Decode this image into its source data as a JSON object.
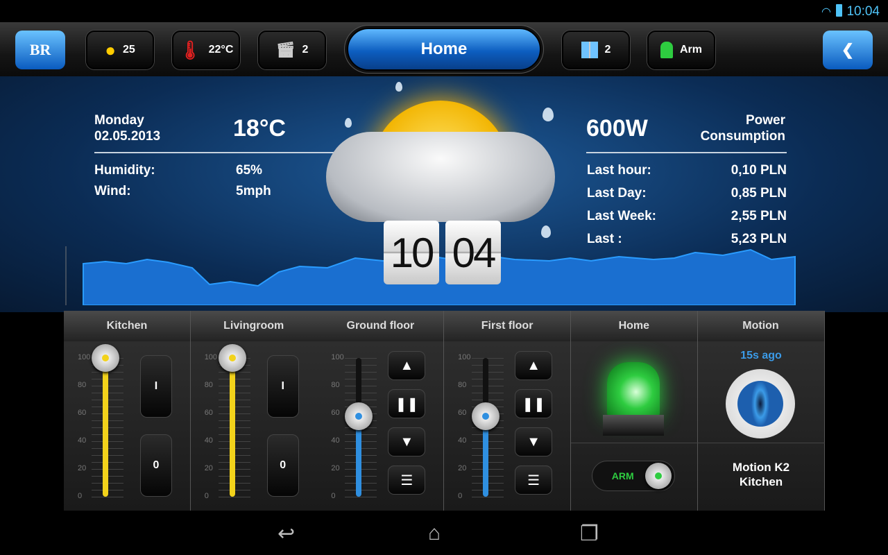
{
  "status_bar": {
    "time": "10:04",
    "icons": [
      "wifi-icon",
      "battery-icon"
    ]
  },
  "toolbar": {
    "logo": "BR",
    "lights": {
      "icon": "bulb-icon",
      "value": "25"
    },
    "temperature": {
      "icon": "thermometer-icon",
      "value": "22°C"
    },
    "scenes": {
      "icon": "clapperboard-icon",
      "value": "2"
    },
    "title": "Home",
    "windows": {
      "icon": "window-icon",
      "value": "2"
    },
    "alarm": {
      "icon": "siren-icon",
      "value": "Arm"
    },
    "back_icon": "chevron-left-icon"
  },
  "weather": {
    "day": "Monday",
    "date": "02.05.2013",
    "temperature": "18°C",
    "humidity_label": "Humidity:",
    "humidity": "65%",
    "wind_label": "Wind:",
    "wind": "5mph",
    "condition_icon": "sun-cloud-rain-icon"
  },
  "clock": {
    "hours": "10",
    "minutes": "04"
  },
  "power": {
    "value": "600W",
    "label_line1": "Power",
    "label_line2": "Consumption",
    "rows": [
      {
        "label": "Last hour:",
        "value": "0,10 PLN"
      },
      {
        "label": "Last Day:",
        "value": "0,85 PLN"
      },
      {
        "label": "Last Week:",
        "value": "2,55 PLN"
      },
      {
        "label": "Last :",
        "value": "5,23 PLN"
      }
    ]
  },
  "scale_ticks": [
    "100",
    "80",
    "60",
    "40",
    "20",
    "0"
  ],
  "tiles": {
    "kitchen": {
      "title": "Kitchen",
      "level": 100,
      "on": "I",
      "off": "0",
      "color": "#f2d21b"
    },
    "livingroom": {
      "title": "Livingroom",
      "level": 100,
      "on": "I",
      "off": "0",
      "color": "#f2d21b"
    },
    "ground_floor": {
      "title": "Ground floor",
      "level": 58,
      "color": "#2f8fe0",
      "buttons": [
        "▲",
        "❚❚",
        "▼",
        "☰"
      ]
    },
    "first_floor": {
      "title": "First floor",
      "level": 58,
      "color": "#2f8fe0",
      "buttons": [
        "▲",
        "❚❚",
        "▼",
        "☰"
      ]
    },
    "home": {
      "title": "Home",
      "toggle": "ARM",
      "armed": true,
      "color": "#2ecc40"
    },
    "motion": {
      "title": "Motion",
      "ago": "15s ago",
      "name_line1": "Motion K2",
      "name_line2": "Kitchen",
      "accent": "#3b9be8"
    }
  },
  "navbar": {
    "back": "back-icon",
    "home": "home-icon",
    "recents": "recents-icon"
  }
}
